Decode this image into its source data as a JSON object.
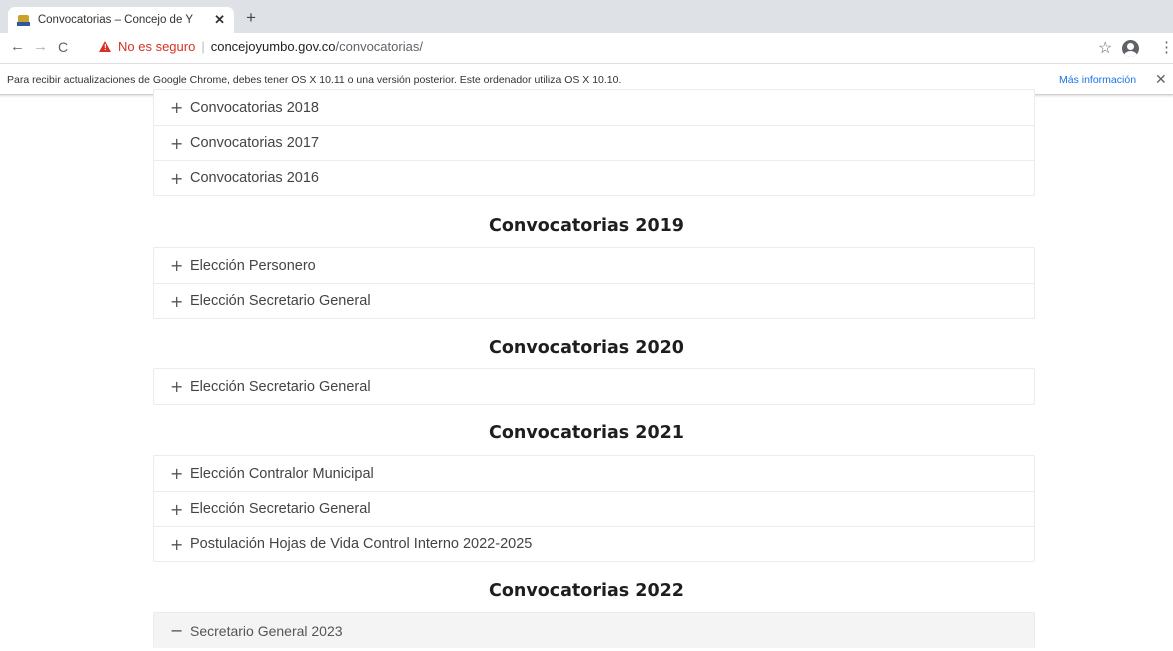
{
  "browser": {
    "tab_title": "Convocatorias – Concejo de Y",
    "tab_close": "✕",
    "new_tab": "+",
    "security_label": "No es seguro",
    "url_host": "concejoyumbo.gov.co",
    "url_path": "/convocatorias/"
  },
  "infobar": {
    "message": "Para recibir actualizaciones de Google Chrome, debes tener OS X 10.11 o una versión posterior. Este ordenador utiliza OS X 10.10.",
    "link": "Más información",
    "close": "✕"
  },
  "top_group": {
    "items": [
      {
        "sign": "+",
        "label": "Convocatorias 2018"
      },
      {
        "sign": "+",
        "label": "Convocatorias 2017"
      },
      {
        "sign": "+",
        "label": "Convocatorias 2016"
      }
    ]
  },
  "sections": [
    {
      "heading": "Convocatorias 2019",
      "items": [
        {
          "sign": "+",
          "label": "Elección Personero"
        },
        {
          "sign": "+",
          "label": "Elección Secretario General"
        }
      ]
    },
    {
      "heading": "Convocatorias 2020",
      "items": [
        {
          "sign": "+",
          "label": "Elección Secretario General"
        }
      ]
    },
    {
      "heading": "Convocatorias 2021",
      "items": [
        {
          "sign": "+",
          "label": "Elección Contralor Municipal"
        },
        {
          "sign": "+",
          "label": "Elección Secretario General"
        },
        {
          "sign": "+",
          "label": "Postulación Hojas de Vida Control Interno 2022-2025"
        }
      ]
    },
    {
      "heading": "Convocatorias 2022",
      "items": [
        {
          "sign": "−",
          "label": "Secretario General 2023",
          "expanded": true
        }
      ]
    }
  ],
  "colors": {
    "warning": "#d93025",
    "link": "#1a73e8",
    "tabstrip": "#dee1e6"
  }
}
